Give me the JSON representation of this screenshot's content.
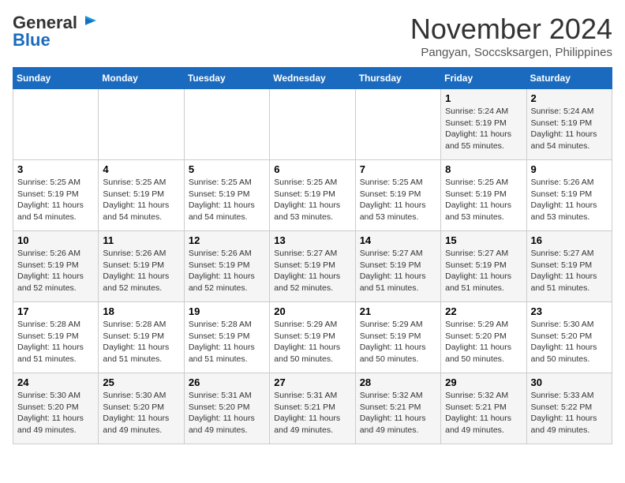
{
  "logo": {
    "general": "General",
    "blue": "Blue"
  },
  "header": {
    "month": "November 2024",
    "location": "Pangyan, Soccsksargen, Philippines"
  },
  "weekdays": [
    "Sunday",
    "Monday",
    "Tuesday",
    "Wednesday",
    "Thursday",
    "Friday",
    "Saturday"
  ],
  "weeks": [
    [
      {
        "day": "",
        "info": ""
      },
      {
        "day": "",
        "info": ""
      },
      {
        "day": "",
        "info": ""
      },
      {
        "day": "",
        "info": ""
      },
      {
        "day": "",
        "info": ""
      },
      {
        "day": "1",
        "info": "Sunrise: 5:24 AM\nSunset: 5:19 PM\nDaylight: 11 hours\nand 55 minutes."
      },
      {
        "day": "2",
        "info": "Sunrise: 5:24 AM\nSunset: 5:19 PM\nDaylight: 11 hours\nand 54 minutes."
      }
    ],
    [
      {
        "day": "3",
        "info": "Sunrise: 5:25 AM\nSunset: 5:19 PM\nDaylight: 11 hours\nand 54 minutes."
      },
      {
        "day": "4",
        "info": "Sunrise: 5:25 AM\nSunset: 5:19 PM\nDaylight: 11 hours\nand 54 minutes."
      },
      {
        "day": "5",
        "info": "Sunrise: 5:25 AM\nSunset: 5:19 PM\nDaylight: 11 hours\nand 54 minutes."
      },
      {
        "day": "6",
        "info": "Sunrise: 5:25 AM\nSunset: 5:19 PM\nDaylight: 11 hours\nand 53 minutes."
      },
      {
        "day": "7",
        "info": "Sunrise: 5:25 AM\nSunset: 5:19 PM\nDaylight: 11 hours\nand 53 minutes."
      },
      {
        "day": "8",
        "info": "Sunrise: 5:25 AM\nSunset: 5:19 PM\nDaylight: 11 hours\nand 53 minutes."
      },
      {
        "day": "9",
        "info": "Sunrise: 5:26 AM\nSunset: 5:19 PM\nDaylight: 11 hours\nand 53 minutes."
      }
    ],
    [
      {
        "day": "10",
        "info": "Sunrise: 5:26 AM\nSunset: 5:19 PM\nDaylight: 11 hours\nand 52 minutes."
      },
      {
        "day": "11",
        "info": "Sunrise: 5:26 AM\nSunset: 5:19 PM\nDaylight: 11 hours\nand 52 minutes."
      },
      {
        "day": "12",
        "info": "Sunrise: 5:26 AM\nSunset: 5:19 PM\nDaylight: 11 hours\nand 52 minutes."
      },
      {
        "day": "13",
        "info": "Sunrise: 5:27 AM\nSunset: 5:19 PM\nDaylight: 11 hours\nand 52 minutes."
      },
      {
        "day": "14",
        "info": "Sunrise: 5:27 AM\nSunset: 5:19 PM\nDaylight: 11 hours\nand 51 minutes."
      },
      {
        "day": "15",
        "info": "Sunrise: 5:27 AM\nSunset: 5:19 PM\nDaylight: 11 hours\nand 51 minutes."
      },
      {
        "day": "16",
        "info": "Sunrise: 5:27 AM\nSunset: 5:19 PM\nDaylight: 11 hours\nand 51 minutes."
      }
    ],
    [
      {
        "day": "17",
        "info": "Sunrise: 5:28 AM\nSunset: 5:19 PM\nDaylight: 11 hours\nand 51 minutes."
      },
      {
        "day": "18",
        "info": "Sunrise: 5:28 AM\nSunset: 5:19 PM\nDaylight: 11 hours\nand 51 minutes."
      },
      {
        "day": "19",
        "info": "Sunrise: 5:28 AM\nSunset: 5:19 PM\nDaylight: 11 hours\nand 51 minutes."
      },
      {
        "day": "20",
        "info": "Sunrise: 5:29 AM\nSunset: 5:19 PM\nDaylight: 11 hours\nand 50 minutes."
      },
      {
        "day": "21",
        "info": "Sunrise: 5:29 AM\nSunset: 5:19 PM\nDaylight: 11 hours\nand 50 minutes."
      },
      {
        "day": "22",
        "info": "Sunrise: 5:29 AM\nSunset: 5:20 PM\nDaylight: 11 hours\nand 50 minutes."
      },
      {
        "day": "23",
        "info": "Sunrise: 5:30 AM\nSunset: 5:20 PM\nDaylight: 11 hours\nand 50 minutes."
      }
    ],
    [
      {
        "day": "24",
        "info": "Sunrise: 5:30 AM\nSunset: 5:20 PM\nDaylight: 11 hours\nand 49 minutes."
      },
      {
        "day": "25",
        "info": "Sunrise: 5:30 AM\nSunset: 5:20 PM\nDaylight: 11 hours\nand 49 minutes."
      },
      {
        "day": "26",
        "info": "Sunrise: 5:31 AM\nSunset: 5:20 PM\nDaylight: 11 hours\nand 49 minutes."
      },
      {
        "day": "27",
        "info": "Sunrise: 5:31 AM\nSunset: 5:21 PM\nDaylight: 11 hours\nand 49 minutes."
      },
      {
        "day": "28",
        "info": "Sunrise: 5:32 AM\nSunset: 5:21 PM\nDaylight: 11 hours\nand 49 minutes."
      },
      {
        "day": "29",
        "info": "Sunrise: 5:32 AM\nSunset: 5:21 PM\nDaylight: 11 hours\nand 49 minutes."
      },
      {
        "day": "30",
        "info": "Sunrise: 5:33 AM\nSunset: 5:22 PM\nDaylight: 11 hours\nand 49 minutes."
      }
    ]
  ]
}
